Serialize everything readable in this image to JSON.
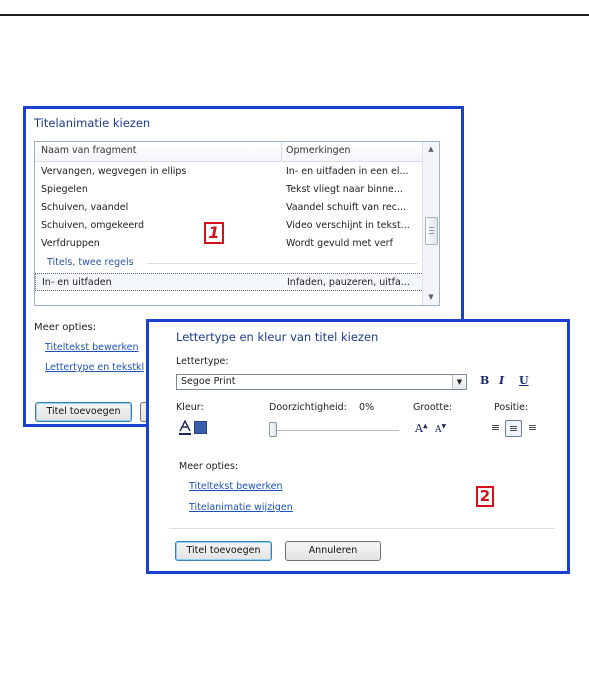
{
  "panel1": {
    "title": "Titelanimatie kiezen",
    "columns": [
      "Naam van fragment",
      "Opmerkingen"
    ],
    "rows": [
      {
        "name": "Vervangen, wegvegen in ellips",
        "note": "In- en uitfaden in een el..."
      },
      {
        "name": "Spiegelen",
        "note": "Tekst vliegt naar binne..."
      },
      {
        "name": "Schuiven, vaandel",
        "note": "Vaandel schuift van rec..."
      },
      {
        "name": "Schuiven, omgekeerd",
        "note": "Video verschijnt in tekst..."
      },
      {
        "name": "Verfdruppen",
        "note": "Wordt gevuld met verf"
      }
    ],
    "group_label": "Titels, twee regels",
    "selected_row": {
      "name": "In- en uitfaden",
      "note": "Infaden, pauzeren, uitfa..."
    },
    "more_options_label": "Meer opties:",
    "link_edit_title": "Titeltekst bewerken",
    "link_font_color": "Lettertype en tekstkl",
    "add_title_button": "Titel toevoegen",
    "badge": "1"
  },
  "panel2": {
    "title": "Lettertype en kleur van titel kiezen",
    "font_label": "Lettertype:",
    "font_value": "Segoe Print",
    "bold_label": "B",
    "italic_label": "I",
    "underline_label": "U",
    "color_label": "Kleur:",
    "transparency_label": "Doorzichtigheid:",
    "transparency_value": "0%",
    "size_label": "Grootte:",
    "position_label": "Positie:",
    "font_grow_label": "A",
    "font_shrink_label": "A",
    "more_options_label": "Meer opties:",
    "link_edit_title": "Titeltekst bewerken",
    "link_change_animation": "Titelanimatie wijzigen",
    "add_title_button": "Titel toevoegen",
    "cancel_button": "Annuleren",
    "badge": "2",
    "selected_alignment": "center"
  },
  "colors": {
    "panel_border": "#1b3fcf",
    "badge": "#d4101d",
    "link": "#1d53b7",
    "swatch": "#3a5fa8"
  },
  "icons": {
    "scroll_up": "triangle-up",
    "scroll_down": "triangle-down",
    "dropdown": "triangle-down",
    "align_left": "align-left-icon",
    "align_center": "align-center-icon",
    "align_right": "align-right-icon",
    "font_color": "font-color-icon",
    "color_swatch": "color-swatch-icon"
  }
}
